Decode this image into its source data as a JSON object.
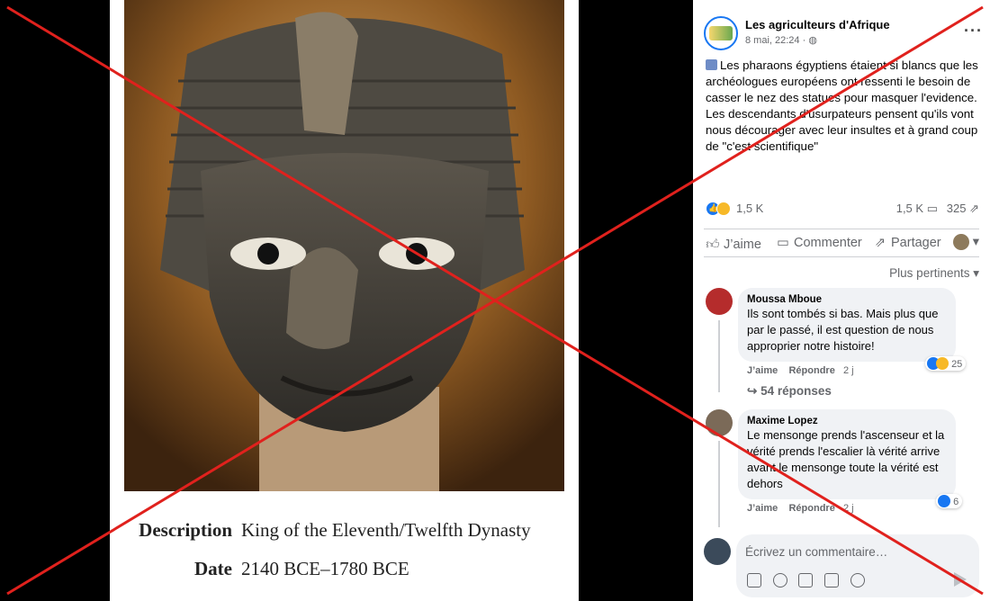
{
  "viewer": {
    "description_label": "Description",
    "description_value": "King of the Eleventh/Twelfth Dynasty",
    "date_label": "Date",
    "date_value": "2140 BCE–1780 BCE"
  },
  "post": {
    "page_name": "Les agriculteurs d'Afrique",
    "time": "8 mai, 22:24 · ",
    "more_label": "···",
    "text_lines": [
      "Les pharaons égyptiens étaient si blancs que les archéologues européens ont ressenti le besoin de casser le nez des statues pour masquer l'evidence.",
      "Les descendants d'usurpateurs pensent qu'ils vont nous décourager avec leur insultes et à grand coup de \"c'est scientifique\""
    ],
    "reaction_count": "1,5 K",
    "comment_count": "1,5 K",
    "share_count": "325",
    "actions": {
      "like": "J’aime",
      "comment": "Commenter",
      "share": "Partager"
    },
    "sort_label": "Plus pertinents ▾"
  },
  "comments": [
    {
      "name": "Moussa Mboue",
      "text": "Ils sont tombés si bas. Mais plus que par le passé, il est question de nous approprier notre histoire!",
      "like_label": "J’aime",
      "reply_label": "Répondre",
      "age": "2 j",
      "reaction_count": "25",
      "replies_label": "54 réponses"
    },
    {
      "name": "Maxime Lopez",
      "text": "Le mensonge prends l'ascenseur et la vérité prends l'escalier là vérité arrive avant le mensonge toute la vérité est dehors",
      "like_label": "J’aime",
      "reply_label": "Répondre",
      "age": "2 j",
      "reaction_count": "6"
    }
  ],
  "composer": {
    "placeholder": "Écrivez un commentaire…"
  },
  "colors": {
    "accent": "#1877f2",
    "cross": "#e0211d",
    "bubble": "#f0f2f5",
    "muted_text": "#65676b"
  },
  "icons": [
    "globe-icon",
    "like-icon",
    "comment-icon",
    "share-icon",
    "send-icon",
    "emoji-icon",
    "camera-icon",
    "gif-icon",
    "sticker-icon"
  ]
}
